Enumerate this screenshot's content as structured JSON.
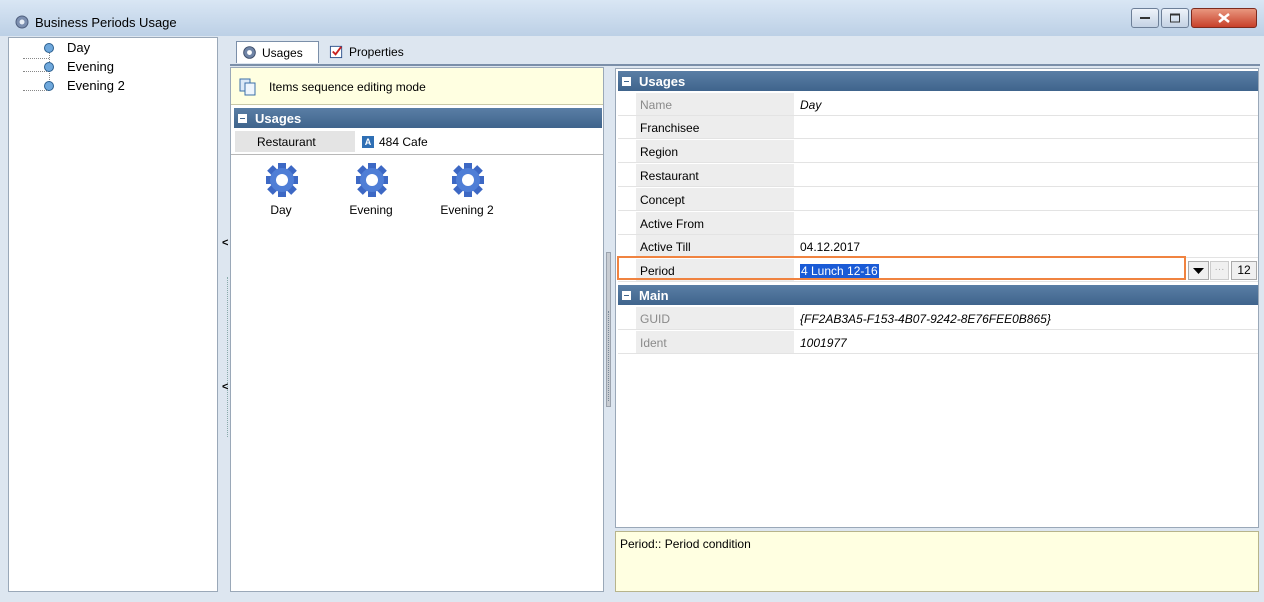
{
  "window": {
    "title": "Business Periods Usage"
  },
  "tree": {
    "items": [
      "Day",
      "Evening",
      "Evening 2"
    ]
  },
  "tabs": [
    {
      "label": "Usages",
      "icon": "gear-icon",
      "active": true
    },
    {
      "label": "Properties",
      "icon": "properties-icon",
      "active": false
    }
  ],
  "left_pane": {
    "mode_text": "Items sequence editing mode",
    "section": "Usages",
    "row_key": "Restaurant",
    "row_value": "484 Cafe",
    "row_badge": "A",
    "items": [
      "Day",
      "Evening",
      "Evening 2"
    ]
  },
  "grid": {
    "section_usages": "Usages",
    "section_main": "Main",
    "rows": [
      {
        "key": "Name",
        "value": "Day"
      },
      {
        "key": "Franchisee",
        "value": ""
      },
      {
        "key": "Region",
        "value": ""
      },
      {
        "key": "Restaurant",
        "value": ""
      },
      {
        "key": "Concept",
        "value": ""
      },
      {
        "key": "Active From",
        "value": ""
      },
      {
        "key": "Active Till",
        "value": "04.12.2017"
      },
      {
        "key": "Period",
        "value": "4 Lunch 12-16"
      }
    ],
    "main_rows": [
      {
        "key": "GUID",
        "value": "{FF2AB3A5-F153-4B07-9242-8E76FEE0B865}"
      },
      {
        "key": "Ident",
        "value": "1001977"
      }
    ],
    "period_number": "12",
    "ellipsis": "···"
  },
  "description": "Period:: Period condition",
  "colors": {
    "header_bar": "#4a6f97",
    "highlight": "#f08340",
    "selection": "#1a5bd6",
    "info_bg": "#ffffe1"
  }
}
